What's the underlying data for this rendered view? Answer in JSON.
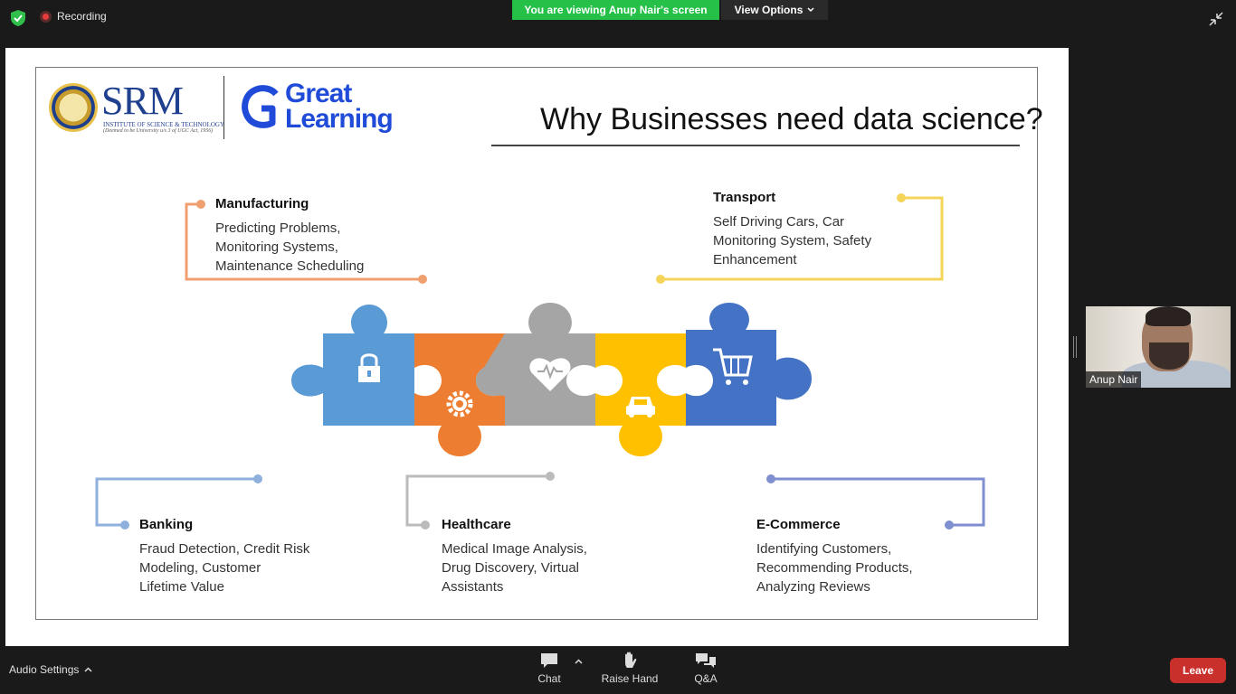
{
  "top": {
    "recording_label": "Recording",
    "viewing_banner": "You are viewing Anup Nair's screen",
    "view_options_label": "View Options"
  },
  "slide": {
    "title": "Why Businesses need data science?",
    "srm": {
      "name": "SRM",
      "subtitle": "INSTITUTE OF SCIENCE & TECHNOLOGY",
      "subtitle2": "(Deemed to be University u/s 3 of UGC Act, 1956)"
    },
    "great_learning": {
      "line1": "Great",
      "line2": "Learning"
    },
    "sections": {
      "manufacturing": {
        "heading": "Manufacturing",
        "body": "Predicting Problems,\nMonitoring Systems,\nMaintenance Scheduling",
        "color": "#f0a070"
      },
      "transport": {
        "heading": "Transport",
        "body": "Self Driving Cars, Car\nMonitoring System, Safety\nEnhancement",
        "color": "#f5d45a"
      },
      "banking": {
        "heading": "Banking",
        "body": "Fraud Detection, Credit Risk\nModeling, Customer\nLifetime Value",
        "color": "#8fb0dc"
      },
      "healthcare": {
        "heading": "Healthcare",
        "body": "Medical Image Analysis,\nDrug Discovery, Virtual\nAssistants",
        "color": "#bbbbbb"
      },
      "ecommerce": {
        "heading": "E-Commerce",
        "body": "Identifying Customers,\nRecommending Products,\nAnalyzing Reviews",
        "color": "#7f8fd0"
      }
    },
    "puzzle_pieces": [
      {
        "icon": "lock-icon",
        "color": "#5b9bd5"
      },
      {
        "icon": "gear-icon",
        "color": "#ed7d31"
      },
      {
        "icon": "heart-pulse-icon",
        "color": "#a5a5a5"
      },
      {
        "icon": "car-icon",
        "color": "#ffc000"
      },
      {
        "icon": "cart-icon",
        "color": "#4472c4"
      }
    ]
  },
  "participant": {
    "name": "Anup Nair"
  },
  "bottom": {
    "audio_settings": "Audio Settings",
    "chat": "Chat",
    "raise_hand": "Raise Hand",
    "qa": "Q&A",
    "leave": "Leave"
  }
}
